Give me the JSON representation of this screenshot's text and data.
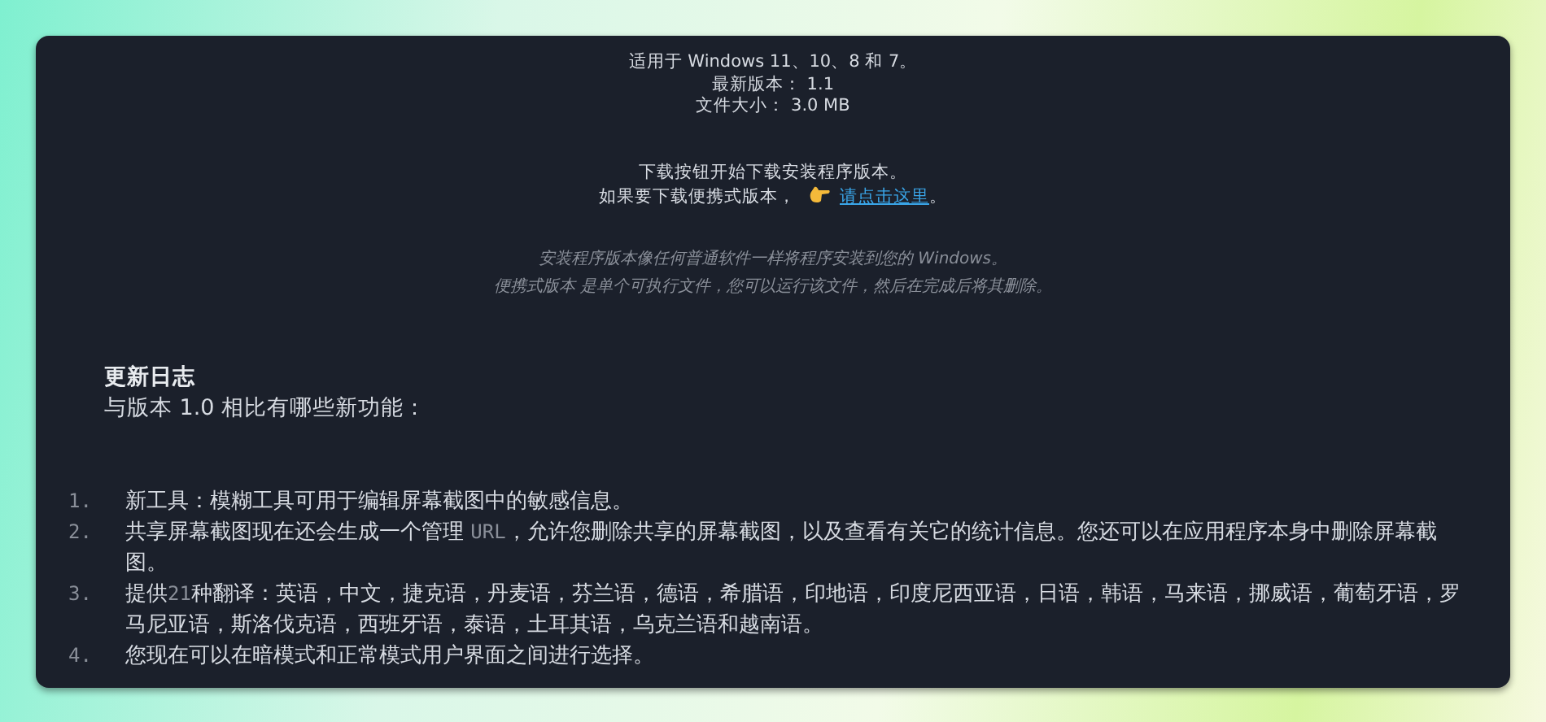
{
  "info_lines": [
    "适用于 Windows 11、10、8 和 7。",
    "最新版本： 1.1",
    "文件大小： 3.0 MB"
  ],
  "download_note": {
    "line_1": "下载按钮开始下载安装程序版本。",
    "line_2_prefix": "如果要下载便携式版本，",
    "link": "请点击这里",
    "line_2_suffix": "。"
  },
  "italic_notes": [
    "安装程序版本像任何普通软件一样将程序安装到您的 Windows。",
    "便携式版本 是单个可执行文件，您可以运行该文件，然后在完成后将其删除。"
  ],
  "changelog": {
    "title": "更新日志",
    "subtitle": "与版本 1.0 相比有哪些新功能："
  },
  "changes": [
    {
      "number": "1.",
      "segments": [
        {
          "kind": "text",
          "text": "新工具：模糊工具可用于编辑屏幕截图中的敏感信息。"
        }
      ]
    },
    {
      "number": "2.",
      "segments": [
        {
          "kind": "text",
          "text": "共享屏幕截图现在还会生成一个管理 "
        },
        {
          "kind": "code",
          "text": "URL"
        },
        {
          "kind": "text",
          "text": "，允许您删除共享的屏幕截图，以及查看有关它的统计信息。您还可以在应用程序本身中删除屏幕截图。"
        }
      ]
    },
    {
      "number": "3.",
      "segments": [
        {
          "kind": "text",
          "text": "提供"
        },
        {
          "kind": "code",
          "text": "21"
        },
        {
          "kind": "text",
          "text": "种翻译：英语，中文，捷克语，丹麦语，芬兰语，德语，希腊语，印地语，印度尼西亚语，日语，韩语，马来语，挪威语，葡萄牙语，罗马尼亚语，斯洛伐克语，西班牙语，泰语，土耳其语，乌克兰语和越南语。"
        }
      ]
    },
    {
      "number": "4.",
      "segments": [
        {
          "kind": "text",
          "text": "您现在可以在暗模式和正常模式用户界面之间进行选择。"
        }
      ]
    }
  ]
}
